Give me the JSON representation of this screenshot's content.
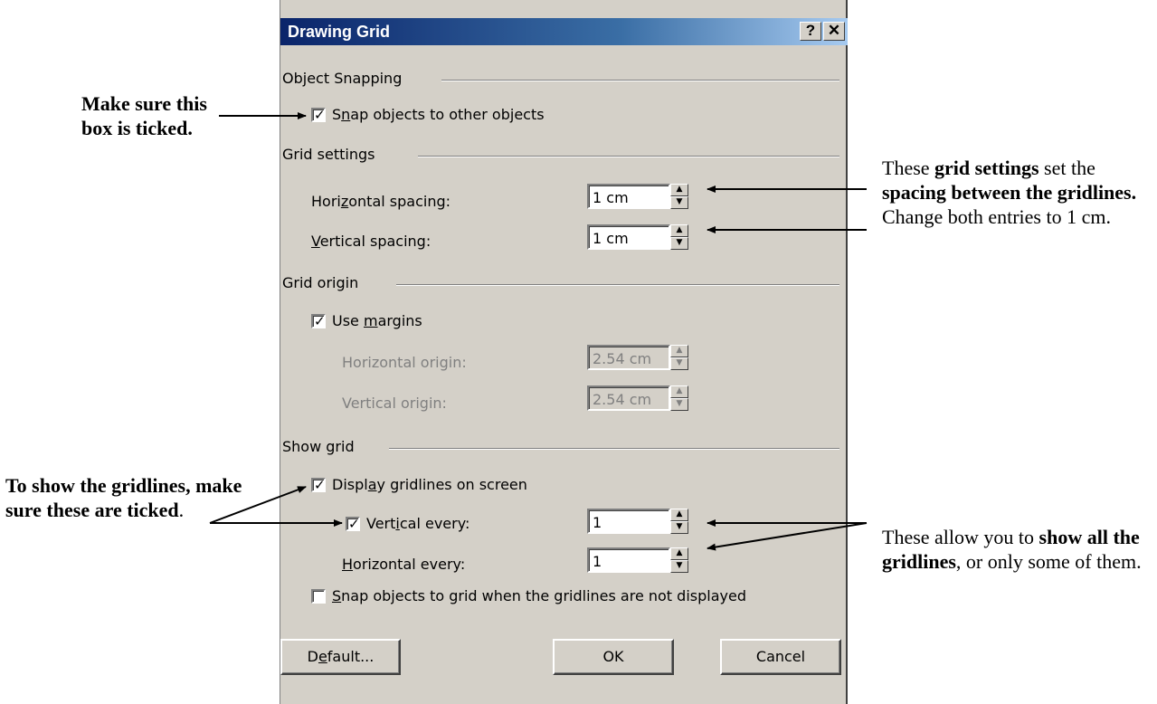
{
  "annotations": {
    "tick": [
      "Make sure this",
      "box is ticked."
    ],
    "grid_settings": {
      "p1": "These ",
      "b1": "grid settings",
      "p2": " set the ",
      "b2": "spacing between the gridlines.",
      "p3": "  Change both entries to 1 cm."
    },
    "show_gridlines": {
      "b1": "To show the gridlines, make sure these are ticked",
      "p1": "."
    },
    "allow": {
      "p1": "These allow you to ",
      "b1": "show all the gridlines",
      "p2": ", or only some of them."
    }
  },
  "dialog": {
    "title": "Drawing Grid",
    "help_btn": "?",
    "close_btn": "✕",
    "object_snapping": {
      "group": "Object Snapping",
      "snap_objects": {
        "pre": "S",
        "u": "n",
        "post": "ap objects to other objects",
        "checked": true
      }
    },
    "grid_settings": {
      "group": "Grid settings",
      "horizontal": {
        "pre": "Hori",
        "u": "z",
        "post": "ontal spacing:",
        "value": "1 cm"
      },
      "vertical": {
        "pre": "",
        "u": "V",
        "post": "ertical spacing:",
        "value": "1 cm"
      }
    },
    "grid_origin": {
      "group": "Grid origin",
      "use_margins": {
        "pre": "Use ",
        "u": "m",
        "post": "argins",
        "checked": true
      },
      "horizontal_origin": {
        "label": "Horizontal origin:",
        "value": "2.54 cm"
      },
      "vertical_origin": {
        "label": "Vertical origin:",
        "value": "2.54 cm"
      }
    },
    "show_grid": {
      "group": "Show grid",
      "display": {
        "pre": "Displ",
        "u": "a",
        "post": "y gridlines on screen",
        "checked": true
      },
      "vertical_every": {
        "pre": "Vert",
        "u": "i",
        "post": "cal every:",
        "value": "1",
        "checked": true
      },
      "horizontal_every": {
        "pre": "",
        "u": "H",
        "post": "orizontal every:",
        "value": "1"
      },
      "snap_to_grid": {
        "pre": "",
        "u": "S",
        "post": "nap objects to grid when the gridlines are not displayed",
        "checked": false
      }
    },
    "buttons": {
      "default": {
        "pre": "D",
        "u": "e",
        "post": "fault..."
      },
      "ok": "OK",
      "cancel": "Cancel"
    }
  }
}
